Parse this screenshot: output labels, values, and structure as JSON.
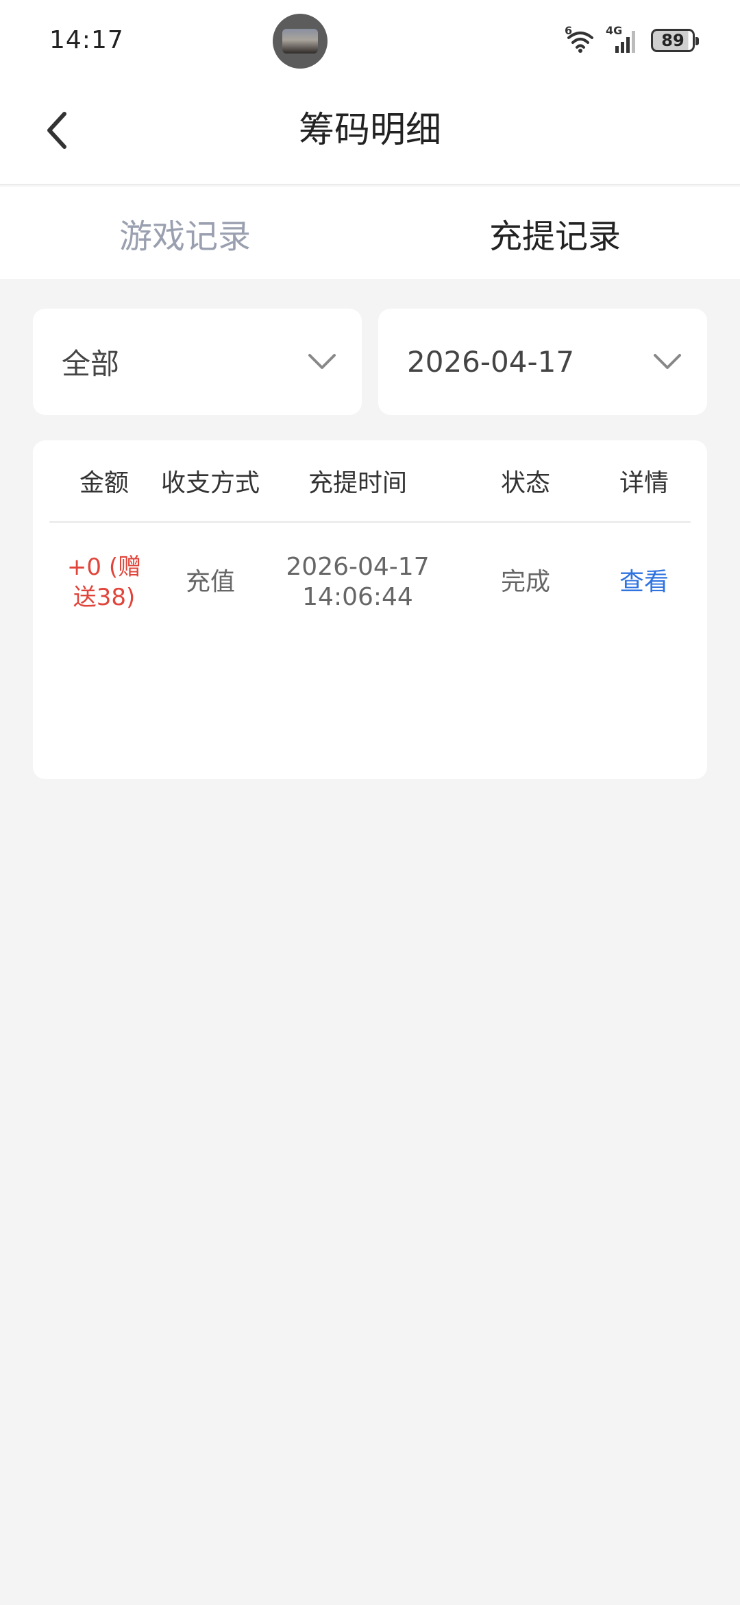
{
  "status_bar": {
    "time": "14:17",
    "network_label": "4G",
    "wifi_label": "6",
    "battery": "89",
    "icons": [
      "wifi-icon",
      "signal-icon",
      "battery-icon"
    ]
  },
  "header": {
    "title": "筹码明细",
    "back_icon": "chevron-left-icon"
  },
  "tabs": [
    {
      "label": "游戏记录",
      "active": false
    },
    {
      "label": "充提记录",
      "active": true
    }
  ],
  "filters": {
    "type_value": "全部",
    "date_value": "2026-04-17",
    "dropdown_icon": "chevron-down-icon"
  },
  "table": {
    "columns": [
      "金额",
      "收支方式",
      "充提时间",
      "状态",
      "详情"
    ],
    "rows": [
      {
        "amount_line1": "+0 (赠",
        "amount_line2": "送38)",
        "method": "充值",
        "date": "2026-04-17",
        "time": "14:06:44",
        "status": "完成",
        "detail": "查看"
      }
    ]
  },
  "colors": {
    "accent_blue": "#2f73e0",
    "amount_red": "#e0443a",
    "background": "#f4f4f4"
  }
}
